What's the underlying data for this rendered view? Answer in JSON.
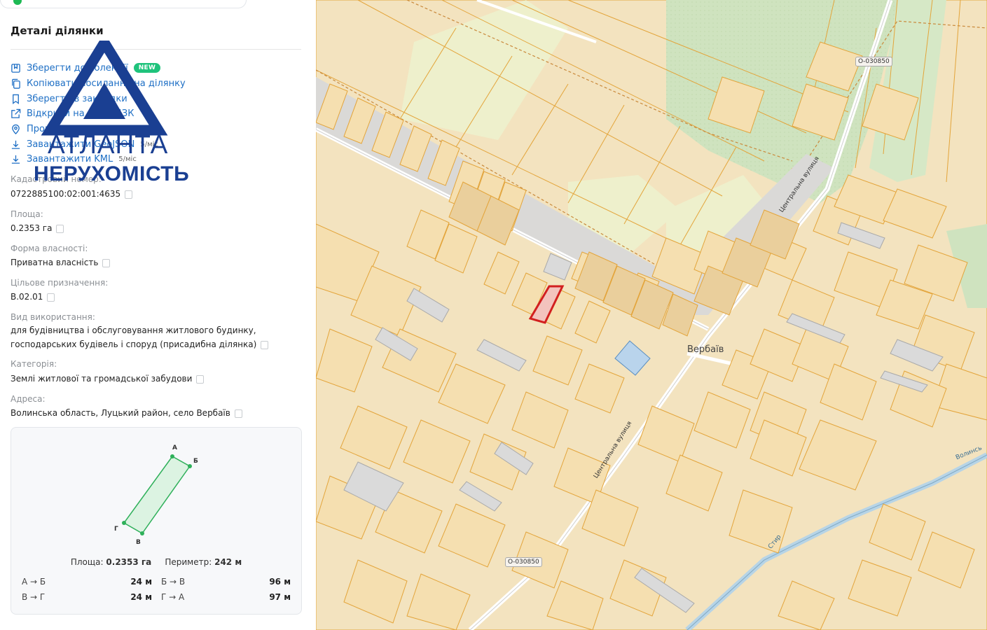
{
  "panel": {
    "title": "Деталі ділянки",
    "actions": [
      {
        "label": "Зберегти до колекції",
        "icon": "bookmark-collection-icon",
        "badge": "NEW"
      },
      {
        "label": "Копіювати посилання на ділянку",
        "icon": "copy-link-icon"
      },
      {
        "label": "Зберегти в закладки",
        "icon": "bookmark-icon"
      },
      {
        "label": "Відкрити на сайті ДЗК",
        "icon": "external-link-icon"
      },
      {
        "label": "Прокласти маршрут",
        "icon": "location-pin-icon"
      },
      {
        "label": "Завантажити GeoJSON",
        "icon": "download-icon",
        "limit": "5/міс"
      },
      {
        "label": "Завантажити KML",
        "icon": "download-icon",
        "limit": "5/міс"
      }
    ],
    "fields": [
      {
        "label": "Кадастровий номер:",
        "value": "0722885100:02:001:4635"
      },
      {
        "label": "Площа:",
        "value": "0.2353 га"
      },
      {
        "label": "Форма власності:",
        "value": "Приватна власність"
      },
      {
        "label": "Цільове призначення:",
        "value": "В.02.01"
      },
      {
        "label": "Вид використання:",
        "value": "для будівництва і обслуговування житлового будинку, господарських будівель і споруд (присадибна ділянка)"
      },
      {
        "label": "Категорія:",
        "value": "Землі житлової та громадської забудови"
      },
      {
        "label": "Адреса:",
        "value": "Волинська область, Луцький район, село Вербаїв"
      }
    ],
    "shape": {
      "vertices": [
        "А",
        "Б",
        "В",
        "Г"
      ],
      "area_label": "Площа:",
      "area_value": "0.2353 га",
      "perimeter_label": "Периметр:",
      "perimeter_value": "242 м",
      "segments": [
        {
          "label": "А → Б",
          "value": "24 м"
        },
        {
          "label": "Б → В",
          "value": "96 м"
        },
        {
          "label": "В → Г",
          "value": "24 м"
        },
        {
          "label": "Г → А",
          "value": "97 м"
        }
      ],
      "color": "#2fb05a"
    }
  },
  "logo": {
    "line1": "АТЛАНТА",
    "line2": "НЕРУХОМІСТЬ",
    "color": "#1a3f92"
  },
  "map": {
    "village_label": "Вербаїв",
    "street_labels": [
      "Центральна вулиця",
      "Центральна вулиця"
    ],
    "road_codes": [
      "О-030850",
      "О-030850"
    ],
    "river_label": "Стир",
    "edge_label": "Волинсь",
    "colors": {
      "parcel_fill": "#f5dfb0",
      "parcel_stroke": "#e3a43a",
      "forest": "#cfe3bf",
      "water": "#b7d4e6",
      "selected": "#d21f1f"
    }
  }
}
